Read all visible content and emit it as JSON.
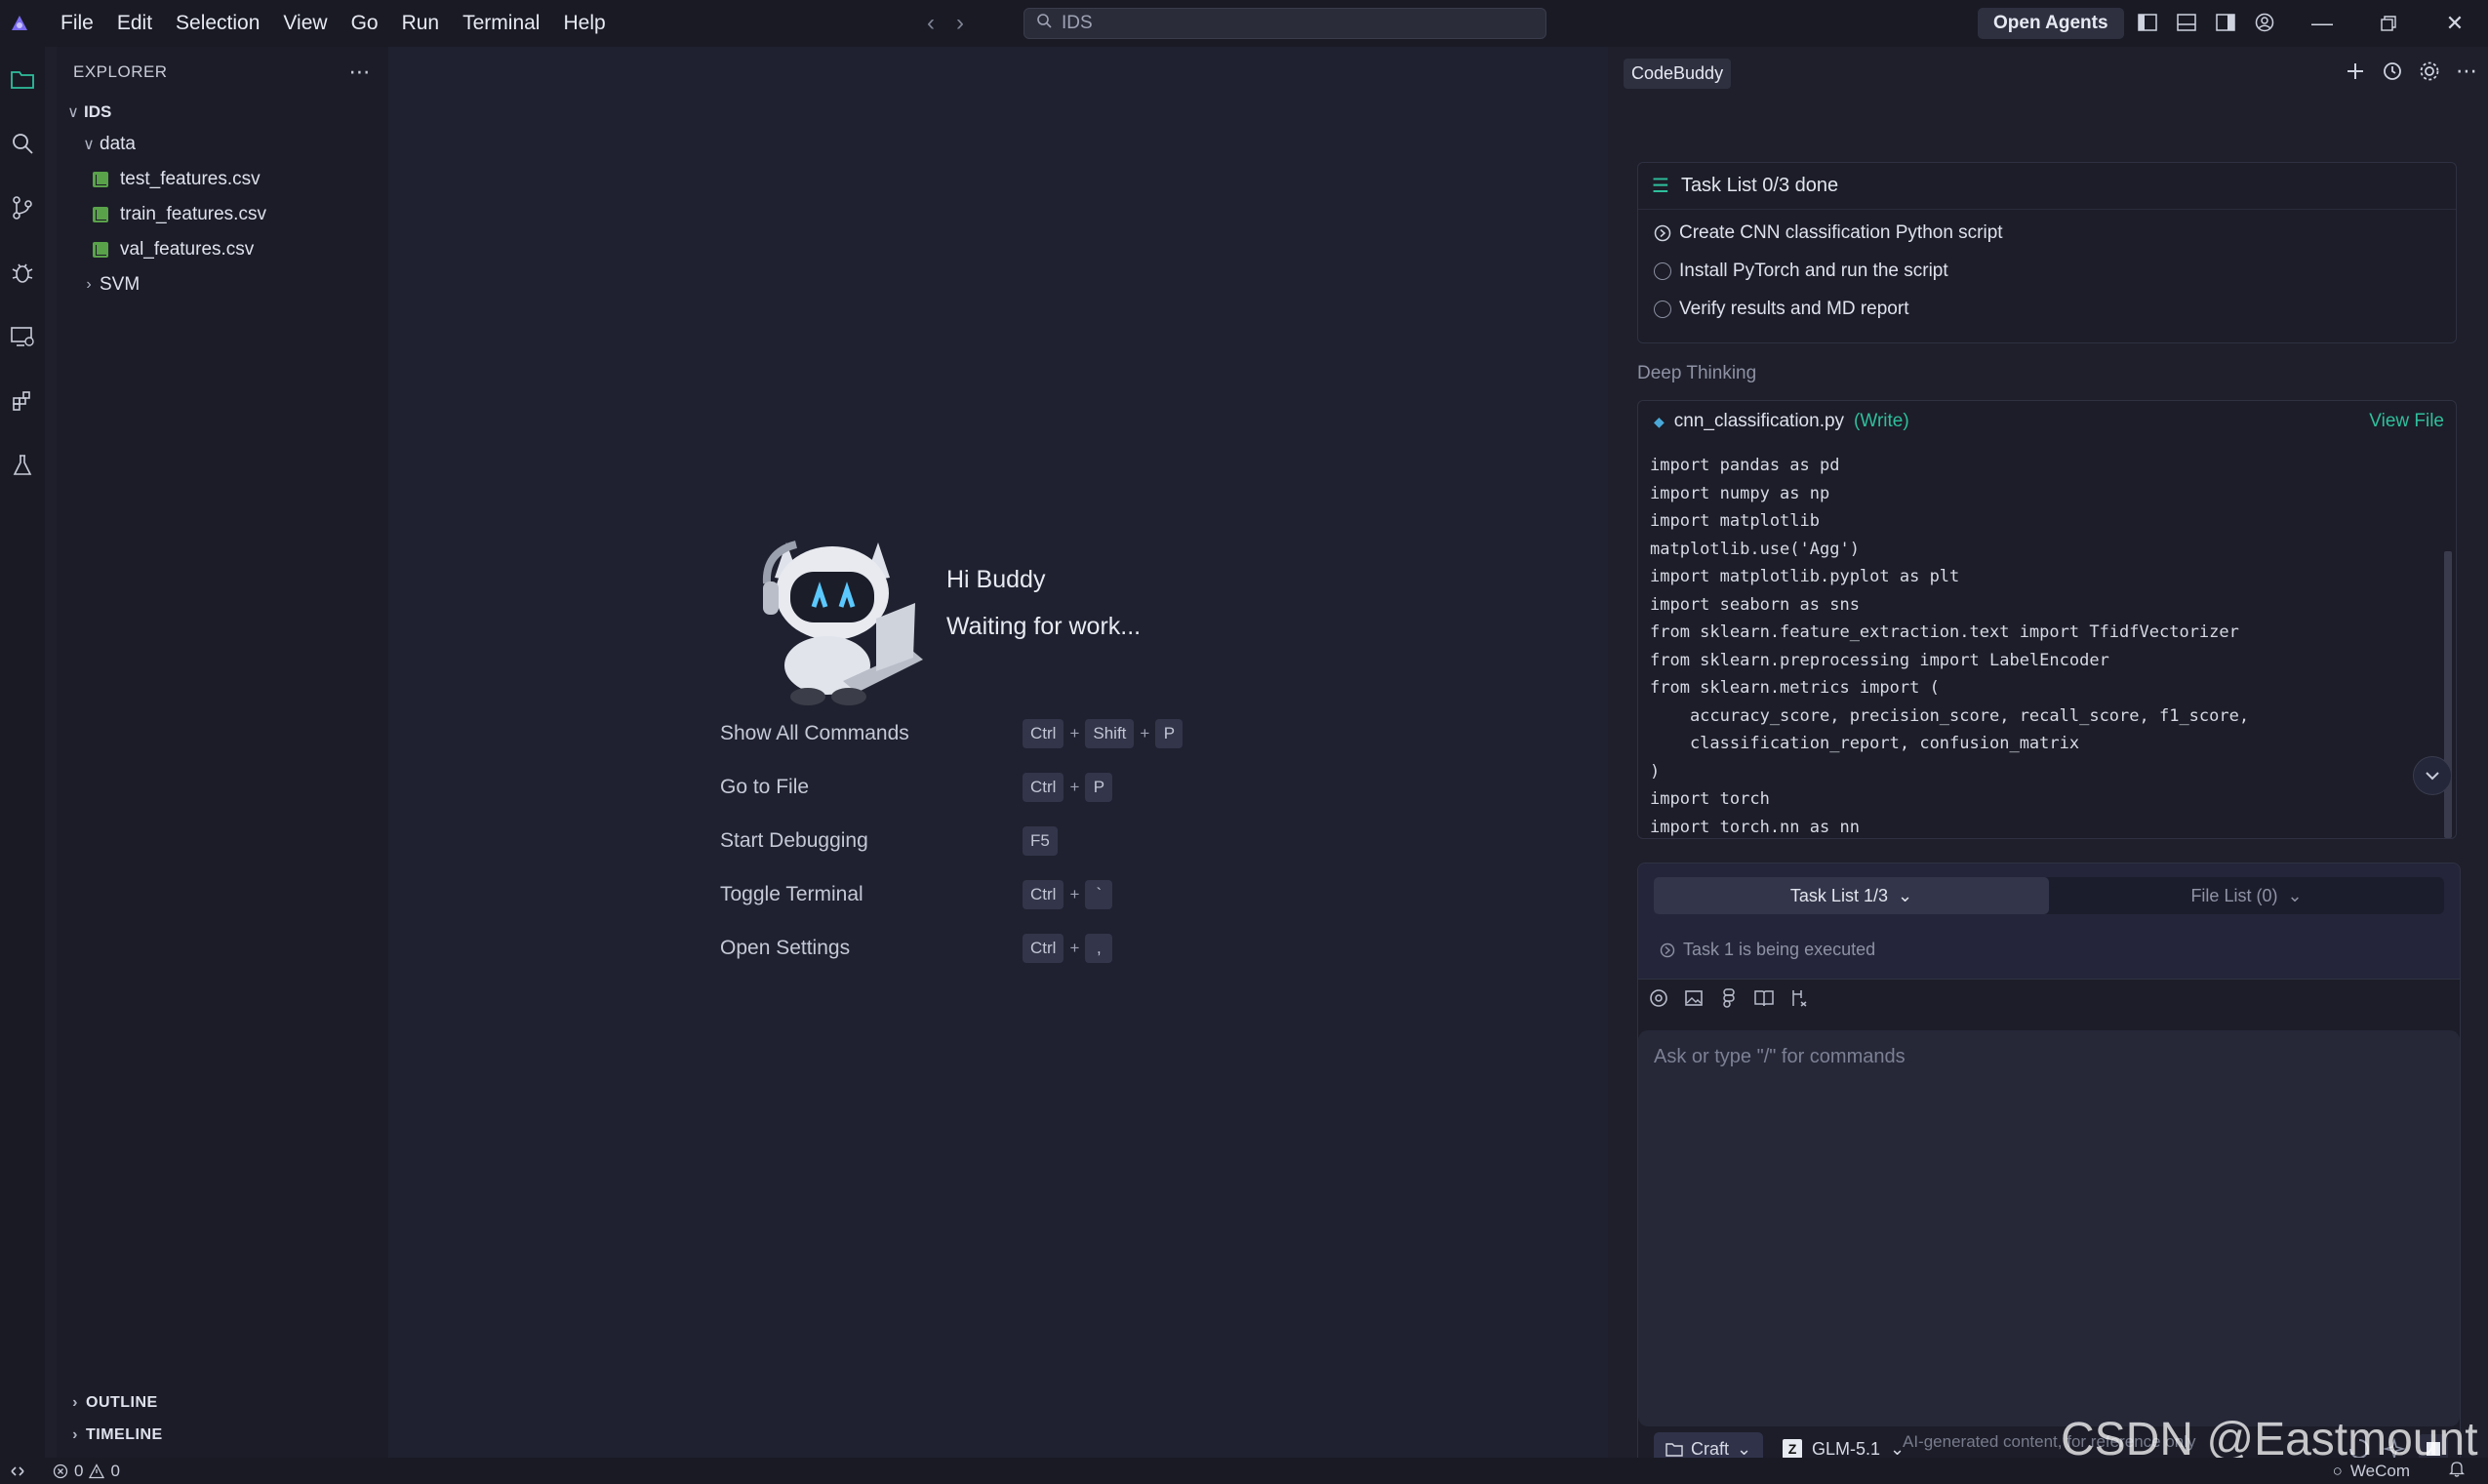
{
  "menu": {
    "items": [
      "File",
      "Edit",
      "Selection",
      "View",
      "Go",
      "Run",
      "Terminal",
      "Help"
    ]
  },
  "titlebar": {
    "search_text": "IDS",
    "open_agents_label": "Open Agents"
  },
  "explorer": {
    "title": "EXPLORER",
    "root": "IDS",
    "data_folder": "data",
    "files": [
      "test_features.csv",
      "train_features.csv",
      "val_features.csv"
    ],
    "svm_folder": "SVM",
    "outline_label": "OUTLINE",
    "timeline_label": "TIMELINE"
  },
  "welcome": {
    "greeting": "Hi Buddy",
    "status": "Waiting for work...",
    "shortcuts": [
      {
        "label": "Show All Commands",
        "keys": [
          "Ctrl",
          "Shift",
          "P"
        ]
      },
      {
        "label": "Go to File",
        "keys": [
          "Ctrl",
          "P"
        ]
      },
      {
        "label": "Start Debugging",
        "keys": [
          "F5"
        ]
      },
      {
        "label": "Toggle Terminal",
        "keys": [
          "Ctrl",
          "`"
        ]
      },
      {
        "label": "Open Settings",
        "keys": [
          "Ctrl",
          ","
        ]
      }
    ]
  },
  "chat": {
    "panel_title": "CodeBuddy",
    "task_list": {
      "title": "Task List 0/3 done",
      "items": [
        "Create CNN classification Python script",
        "Install PyTorch and run the script",
        "Verify results and MD report"
      ]
    },
    "deep_thinking": "Deep Thinking",
    "code_card": {
      "filename": "cnn_classification.py",
      "action": "(Write)",
      "view_file": "View File",
      "code": "import pandas as pd\nimport numpy as np\nimport matplotlib\nmatplotlib.use('Agg')\nimport matplotlib.pyplot as plt\nimport seaborn as sns\nfrom sklearn.feature_extraction.text import TfidfVectorizer\nfrom sklearn.preprocessing import LabelEncoder\nfrom sklearn.metrics import (\n    accuracy_score, precision_score, recall_score, f1_score,\n    classification_report, confusion_matrix\n)\nimport torch\nimport torch.nn as nn"
    },
    "tabs": {
      "task_list": "Task List 1/3",
      "file_list": "File List (0)"
    },
    "exec_status": "Task 1 is being executed",
    "input_placeholder": "Ask or type \"/\" for commands",
    "mode": "Craft",
    "model": "GLM-5.1",
    "ai_note": "AI-generated content, for reference only"
  },
  "watermark": "CSDN @Eastmount",
  "status": {
    "errors": "0",
    "warnings": "0",
    "wecom": "WeCom"
  },
  "colors": {
    "accent": "#2fbf9c",
    "csv": "#5aa24a",
    "background": "#1e1f2b"
  }
}
